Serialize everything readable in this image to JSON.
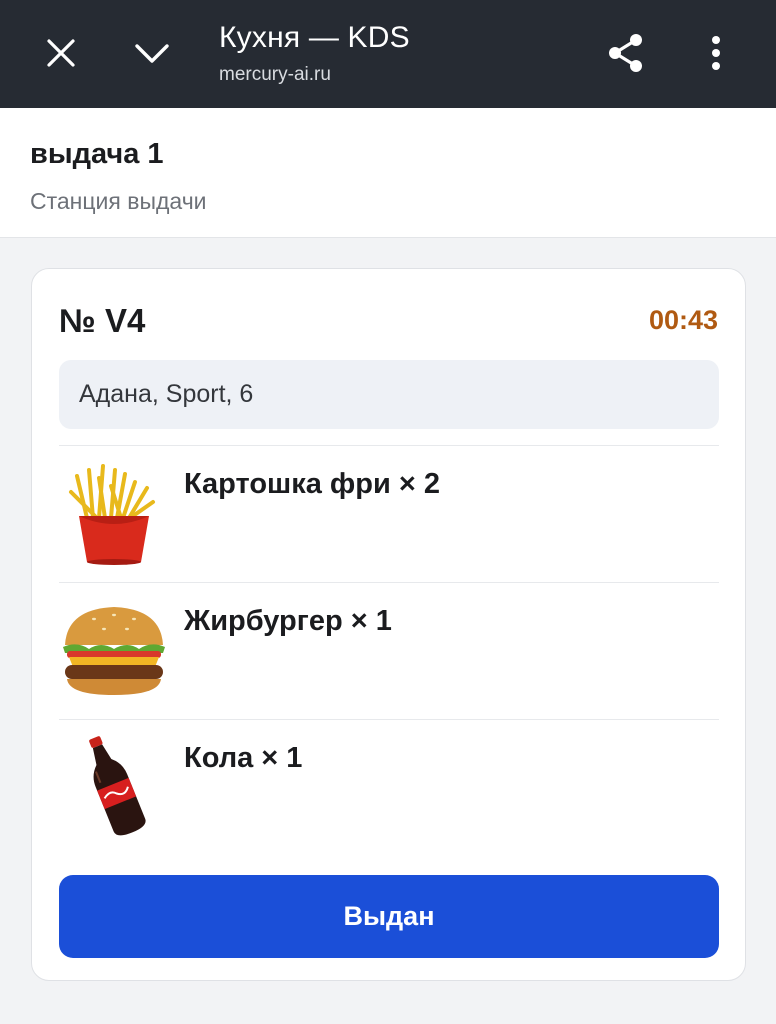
{
  "appbar": {
    "title": "Кухня — KDS",
    "url": "mercury-ai.ru",
    "icons": [
      "close-icon",
      "chevron-down-icon",
      "share-icon",
      "more-vertical-icon"
    ],
    "background": "#262b33"
  },
  "station": {
    "name": "выдача 1",
    "description": "Станция выдачи"
  },
  "order": {
    "number": "№ V4",
    "timer": "00:43",
    "timer_color": "#b05a12",
    "address": "Адана, Sport, 6",
    "items": [
      {
        "label": "Картошка фри × 2",
        "icon": "french-fries-image"
      },
      {
        "label": "Жирбургер × 1",
        "icon": "burger-image"
      },
      {
        "label": "Кола × 1",
        "icon": "cola-bottle-image"
      }
    ],
    "action_label": "Выдан",
    "accent": "#1b4fd8"
  }
}
